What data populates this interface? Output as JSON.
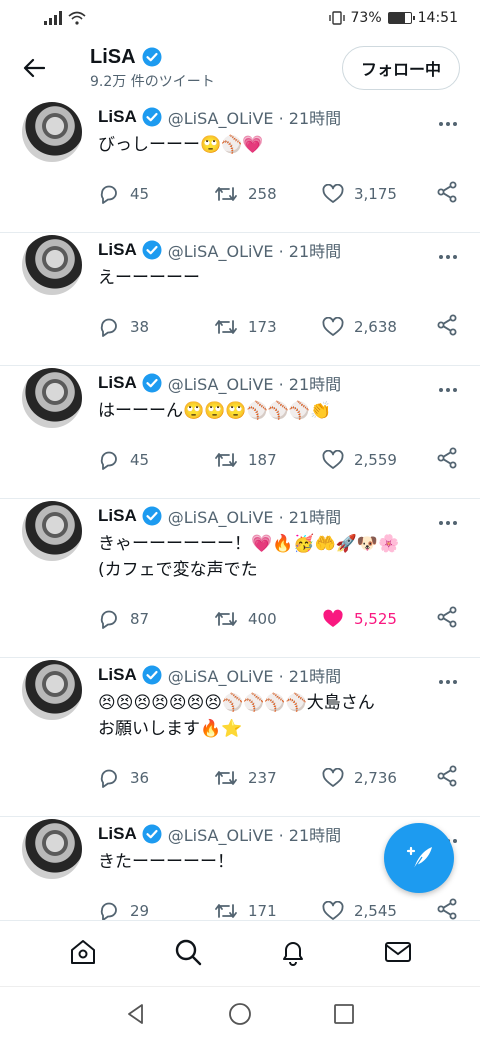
{
  "status": {
    "battery": "73%",
    "time": "14:51"
  },
  "header": {
    "name": "LiSA",
    "tweet_count": "9.2万 件のツイート",
    "follow_label": "フォロー中"
  },
  "colors": {
    "accent": "#1d9bf0",
    "like_active": "#f91880",
    "muted": "#536471"
  },
  "tweets": [
    {
      "name": "LiSA",
      "meta": "@LiSA_OLiVE · 21時間",
      "text": "びっしーーー🙄⚾💗",
      "replies": "45",
      "retweets": "258",
      "likes": "3,175",
      "liked": false
    },
    {
      "name": "LiSA",
      "meta": "@LiSA_OLiVE · 21時間",
      "text": "えーーーーー",
      "replies": "38",
      "retweets": "173",
      "likes": "2,638",
      "liked": false
    },
    {
      "name": "LiSA",
      "meta": "@LiSA_OLiVE · 21時間",
      "text": "はーーーん🙄🙄🙄⚾⚾⚾👏",
      "replies": "45",
      "retweets": "187",
      "likes": "2,559",
      "liked": false
    },
    {
      "name": "LiSA",
      "meta": "@LiSA_OLiVE · 21時間",
      "text": "きゃーーーーーー！💗🔥🥳🤲🚀🐶🌸\n(カフェで変な声でた",
      "replies": "87",
      "retweets": "400",
      "likes": "5,525",
      "liked": true
    },
    {
      "name": "LiSA",
      "meta": "@LiSA_OLiVE · 21時間",
      "text": "😣😣😣😣😣😣😣⚾⚾⚾⚾大島さん\nお願いします🔥⭐",
      "replies": "36",
      "retweets": "237",
      "likes": "2,736",
      "liked": false
    },
    {
      "name": "LiSA",
      "meta": "@LiSA_OLiVE · 21時間",
      "text": "きたーーーーー！",
      "replies": "29",
      "retweets": "171",
      "likes": "2,545",
      "liked": false
    },
    {
      "name": "LiSA",
      "meta": "@LiSA_OLiVE · 21時間",
      "text": "",
      "replies": "",
      "retweets": "",
      "likes": "",
      "liked": false
    }
  ],
  "icons": {
    "back": "arrow-left-icon",
    "verified": "verified-badge-icon",
    "reply": "reply-icon",
    "retweet": "retweet-icon",
    "like": "heart-icon",
    "share": "share-icon",
    "more": "more-icon",
    "compose": "compose-feather-icon",
    "home": "home-icon",
    "search": "search-icon",
    "notifications": "bell-icon",
    "messages": "mail-icon"
  }
}
